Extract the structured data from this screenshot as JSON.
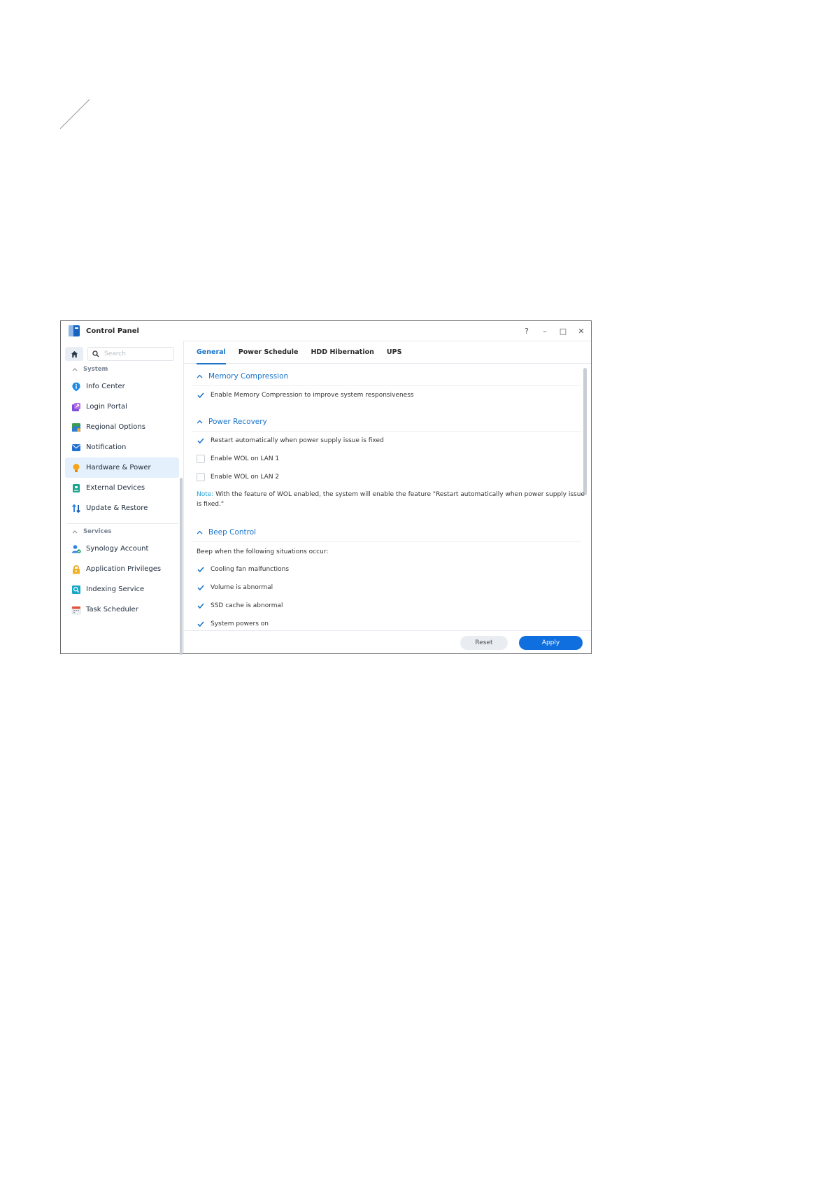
{
  "window": {
    "title": "Control Panel",
    "controls": {
      "help": "?",
      "minimize": "–",
      "maximize": "□",
      "close": "✕"
    }
  },
  "sidebar": {
    "search_placeholder": "Search",
    "groups": [
      {
        "label": "System"
      },
      {
        "label": "Services"
      }
    ],
    "items": [
      {
        "label": "Info Center",
        "icon": "info-icon"
      },
      {
        "label": "Login Portal",
        "icon": "login-portal-icon"
      },
      {
        "label": "Regional Options",
        "icon": "regional-options-icon"
      },
      {
        "label": "Notification",
        "icon": "notification-icon"
      },
      {
        "label": "Hardware & Power",
        "icon": "hardware-power-icon",
        "active": true
      },
      {
        "label": "External Devices",
        "icon": "external-devices-icon"
      },
      {
        "label": "Update & Restore",
        "icon": "update-restore-icon"
      },
      {
        "label": "Synology Account",
        "icon": "synology-account-icon"
      },
      {
        "label": "Application Privileges",
        "icon": "lock-icon"
      },
      {
        "label": "Indexing Service",
        "icon": "indexing-service-icon"
      },
      {
        "label": "Task Scheduler",
        "icon": "calendar-icon"
      }
    ]
  },
  "tabs": [
    {
      "label": "General",
      "active": true
    },
    {
      "label": "Power Schedule"
    },
    {
      "label": "HDD Hibernation"
    },
    {
      "label": "UPS"
    }
  ],
  "sections": {
    "memory": {
      "title": "Memory Compression",
      "options": [
        {
          "label": "Enable Memory Compression to improve system responsiveness",
          "checked": true
        }
      ]
    },
    "power": {
      "title": "Power Recovery",
      "options": [
        {
          "label": "Restart automatically when power supply issue is fixed",
          "checked": true
        },
        {
          "label": "Enable WOL on LAN 1",
          "checked": false
        },
        {
          "label": "Enable WOL on LAN 2",
          "checked": false
        }
      ],
      "note_key": "Note:",
      "note_text": " With the feature of WOL enabled, the system will enable the feature \"Restart automatically when power supply issue is fixed.\""
    },
    "beep": {
      "title": "Beep Control",
      "intro": "Beep when the following situations occur:",
      "options": [
        {
          "label": "Cooling fan malfunctions",
          "checked": true
        },
        {
          "label": "Volume is abnormal",
          "checked": true
        },
        {
          "label": "SSD cache is abnormal",
          "checked": true
        },
        {
          "label": "System powers on",
          "checked": true
        }
      ]
    }
  },
  "footer": {
    "reset": "Reset",
    "apply": "Apply"
  },
  "colors": {
    "accent": "#1a73c9",
    "apply": "#0f6fde",
    "active_nav": "#e4f0fc"
  }
}
